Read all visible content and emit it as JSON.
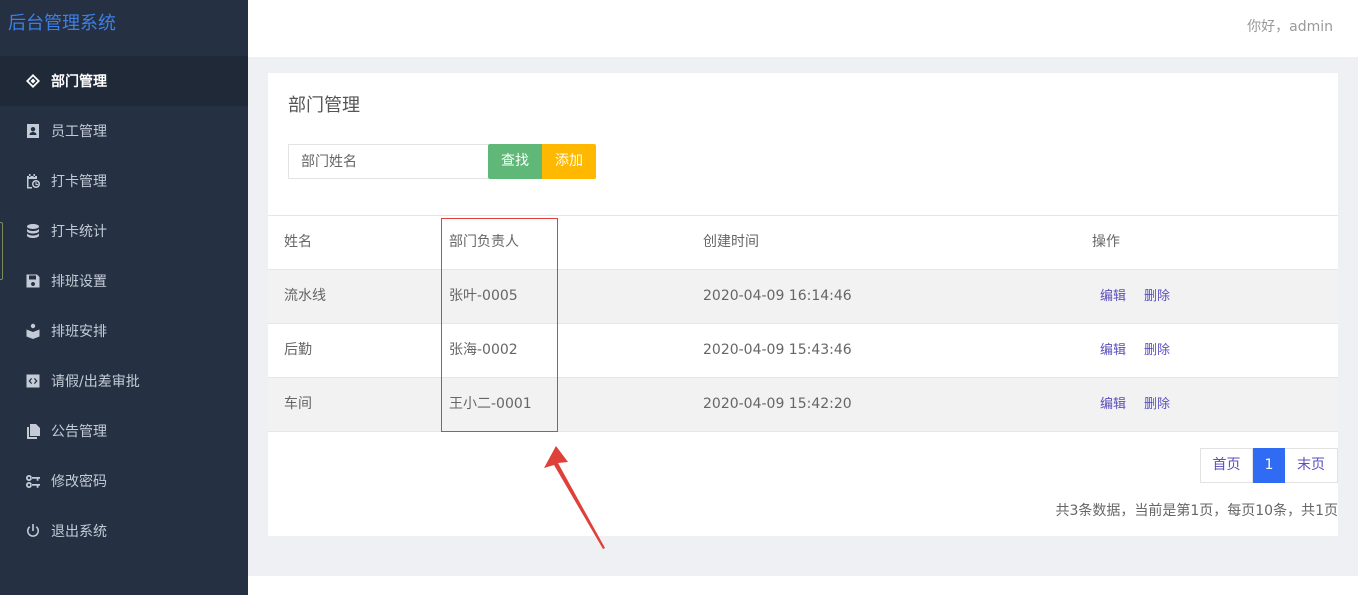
{
  "brand": {
    "title": "后台管理系统"
  },
  "header": {
    "greeting": "你好，admin"
  },
  "sidebar": {
    "items": [
      {
        "label": "部门管理",
        "icon": "cube-icon",
        "active": true
      },
      {
        "label": "员工管理",
        "icon": "id-card-icon",
        "active": false
      },
      {
        "label": "打卡管理",
        "icon": "calendar-clock-icon",
        "active": false
      },
      {
        "label": "打卡统计",
        "icon": "database-icon",
        "active": false
      },
      {
        "label": "排班设置",
        "icon": "floppy-disk-icon",
        "active": false
      },
      {
        "label": "排班安排",
        "icon": "book-reader-icon",
        "active": false
      },
      {
        "label": "请假/出差审批",
        "icon": "code-box-icon",
        "active": false
      },
      {
        "label": "公告管理",
        "icon": "copy-icon",
        "active": false
      },
      {
        "label": "修改密码",
        "icon": "key-icon",
        "active": false
      },
      {
        "label": "退出系统",
        "icon": "power-icon",
        "active": false
      }
    ]
  },
  "main": {
    "title": "部门管理",
    "search": {
      "placeholder": "部门姓名",
      "value": ""
    },
    "buttons": {
      "search": "查找",
      "add": "添加"
    },
    "table": {
      "columns": [
        "姓名",
        "部门负责人",
        "创建时间",
        "操作"
      ],
      "rows": [
        {
          "name": "流水线",
          "manager": "张叶-0005",
          "created": "2020-04-09 16:14:46",
          "edit": "编辑",
          "delete": "删除"
        },
        {
          "name": "后勤",
          "manager": "张海-0002",
          "created": "2020-04-09 15:43:46",
          "edit": "编辑",
          "delete": "删除"
        },
        {
          "name": "车间",
          "manager": "王小二-0001",
          "created": "2020-04-09 15:42:20",
          "edit": "编辑",
          "delete": "删除"
        }
      ]
    },
    "pager": {
      "first": "首页",
      "current": "1",
      "last": "末页",
      "info": "共3条数据，当前是第1页，每页10条，共1页"
    }
  },
  "colors": {
    "sidebar_bg": "#253143",
    "brand": "#3d7fe6",
    "search_button": "#5fb878",
    "add_button": "#ffb800",
    "link": "#5a4fbf",
    "pager_current": "#2f6bf3",
    "annotation": "#e0403a"
  }
}
